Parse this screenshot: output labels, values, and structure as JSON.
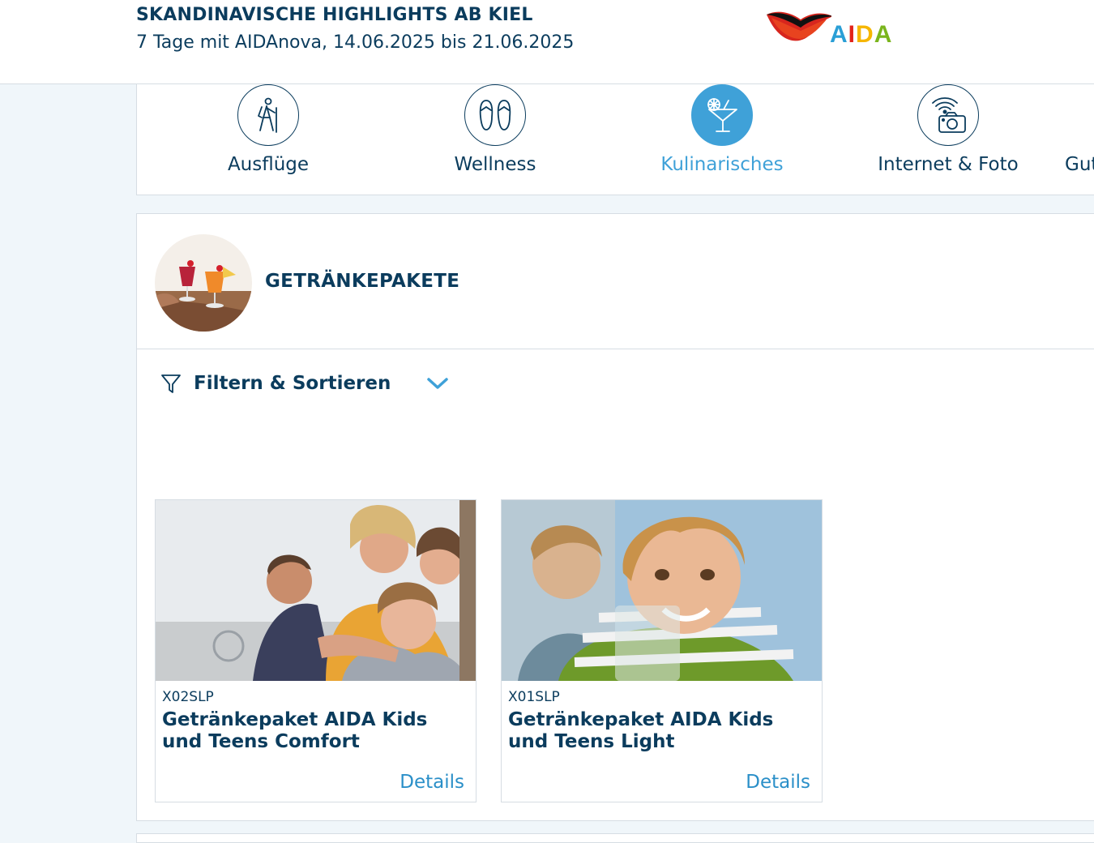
{
  "header": {
    "title": "SKANDINAVISCHE HIGHLIGHTS AB KIEL",
    "subtitle": "7 Tage mit AIDAnova, 14.06.2025 bis 21.06.2025",
    "logo_letters": [
      "A",
      "I",
      "D",
      "A"
    ]
  },
  "categories": [
    {
      "label": "Ausflüge",
      "icon": "hiker-icon",
      "active": false
    },
    {
      "label": "Wellness",
      "icon": "flip-flops-icon",
      "active": false
    },
    {
      "label": "Kulinarisches",
      "icon": "cocktail-icon",
      "active": true
    },
    {
      "label": "Internet & Foto",
      "icon": "wifi-camera-icon",
      "active": false
    },
    {
      "label": "Gut",
      "icon": "",
      "active": false
    }
  ],
  "section": {
    "title": "GETRÄNKEPAKETE",
    "filter_label": "Filtern & Sortieren"
  },
  "products": [
    {
      "code": "X02SLP",
      "name": "Getränkepaket AIDA Kids und Teens Comfort",
      "details_label": "Details"
    },
    {
      "code": "X01SLP",
      "name": "Getränkepaket AIDA Kids und Teens Light",
      "details_label": "Details"
    }
  ],
  "colors": {
    "primary": "#0b3c5d",
    "accent": "#3fa1d8",
    "background": "#f0f6fa"
  }
}
